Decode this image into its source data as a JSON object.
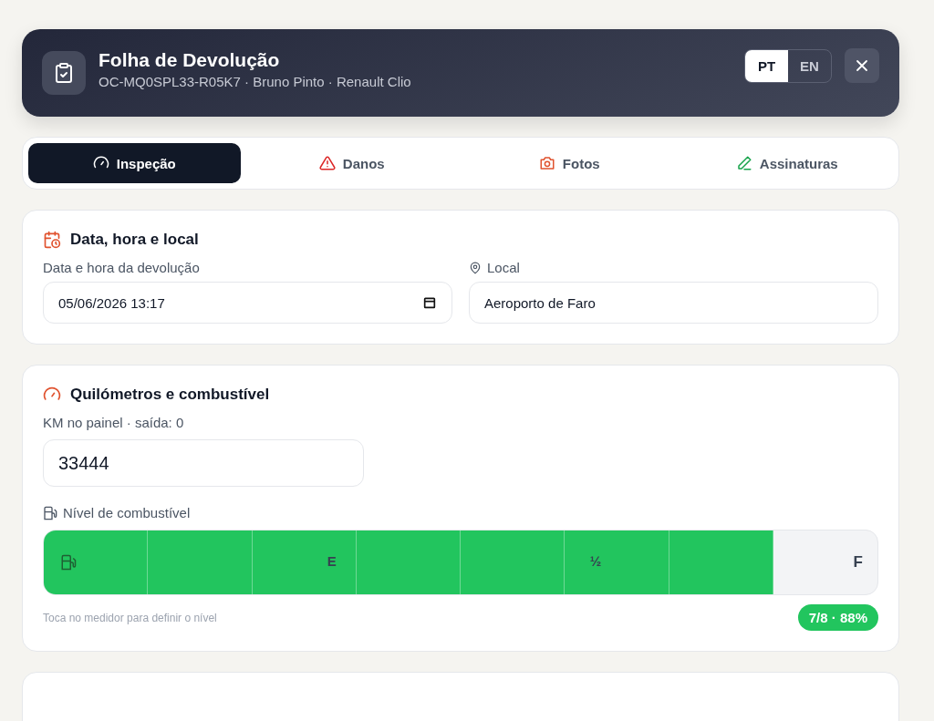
{
  "header": {
    "title": "Folha de Devolução",
    "subtitle": "OC-MQ0SPL33-R05K7 · Bruno Pinto · Renault Clio",
    "languages": [
      {
        "label": "PT",
        "selected": true
      },
      {
        "label": "EN",
        "selected": false
      }
    ]
  },
  "tabs": [
    {
      "label": "Inspeção",
      "kind": "gauge",
      "selected": true
    },
    {
      "label": "Danos",
      "kind": "warning",
      "selected": false
    },
    {
      "label": "Fotos",
      "kind": "camera",
      "selected": false
    },
    {
      "label": "Assinaturas",
      "kind": "pen",
      "selected": false
    }
  ],
  "datetime_card": {
    "title": "Data, hora e local",
    "date_label": "Data e hora da devolução",
    "date_value": "05/06/2026 13:17",
    "location_label": "Local",
    "location_value": "Aeroporto de Faro"
  },
  "km_card": {
    "title": "Quilómetros e combustível",
    "km_label": "KM no painel · saída: 0",
    "km_value": "33444",
    "fuel_label": "Nível de combustível",
    "gauge_marks": [
      "E",
      "½",
      "F"
    ],
    "level": 0.875,
    "hint": "Toca no medidor para definir o nível",
    "reading": "7/8 · 88%"
  }
}
